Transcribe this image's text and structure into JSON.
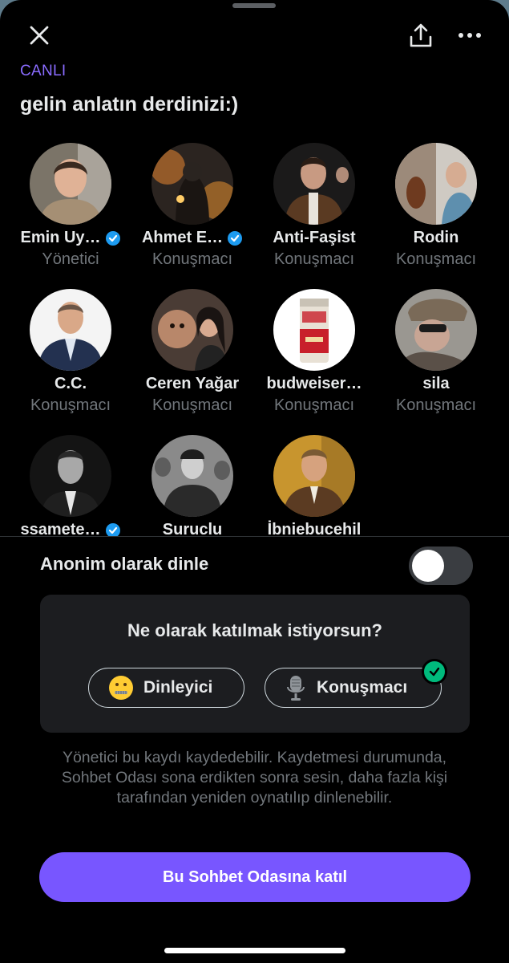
{
  "header": {
    "close_icon": "close-icon",
    "share_icon": "share-icon",
    "more_icon": "more-icon"
  },
  "space": {
    "status": "CANLI",
    "title": "gelin anlatın derdinizi:)"
  },
  "participants": [
    {
      "name": "Emin Uy…",
      "role": "Yönetici",
      "verified": true
    },
    {
      "name": "Ahmet E…",
      "role": "Konuşmacı",
      "verified": true
    },
    {
      "name": "Anti-Faşist",
      "role": "Konuşmacı",
      "verified": false
    },
    {
      "name": "Rodin",
      "role": "Konuşmacı",
      "verified": false
    },
    {
      "name": "C.C.",
      "role": "Konuşmacı",
      "verified": false
    },
    {
      "name": "Ceren Yağar",
      "role": "Konuşmacı",
      "verified": false
    },
    {
      "name": "budweiser…",
      "role": "Konuşmacı",
      "verified": false
    },
    {
      "name": "sila",
      "role": "Konuşmacı",
      "verified": false
    },
    {
      "name": "ssamete…",
      "role": "",
      "verified": true
    },
    {
      "name": "Suruclu",
      "role": "",
      "verified": false
    },
    {
      "name": "İbniebucehil",
      "role": "",
      "verified": false
    }
  ],
  "anonymous": {
    "label": "Anonim olarak dinle",
    "enabled": false
  },
  "join": {
    "question": "Ne olarak katılmak istiyorsun?",
    "listener_label": "Dinleyici",
    "speaker_label": "Konuşmacı",
    "selected": "Konuşmacı"
  },
  "disclaimer": "Yönetici bu kaydı kaydedebilir. Kaydetmesi durumunda, Sohbet Odası sona erdikten sonra sesin, daha fazla kişi tarafından yeniden oynatılıp dinlenebilir.",
  "cta_label": "Bu Sohbet Odasına katıl",
  "colors": {
    "accent": "#7856ff",
    "live": "#8a6cff",
    "verified": "#1d9bf0",
    "check": "#00ba7c"
  }
}
